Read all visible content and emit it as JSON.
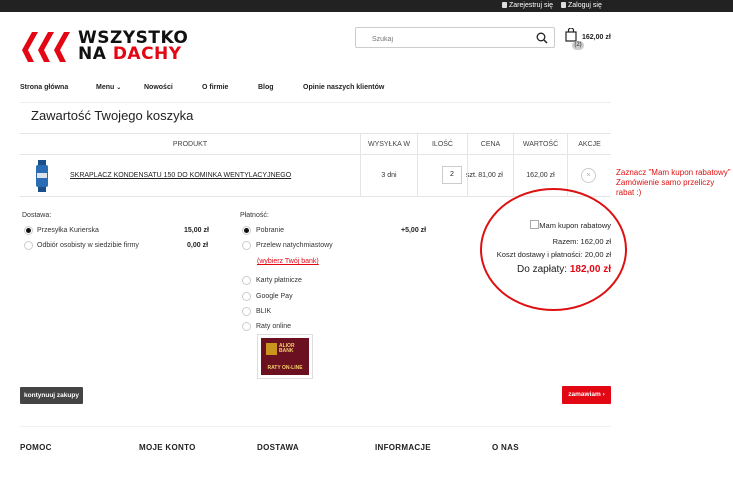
{
  "topbar": {
    "register": "Zarejestruj się",
    "login": "Zaloguj się"
  },
  "logo": {
    "line1": "WSZYSTKO",
    "line2_a": "NA ",
    "line2_b": "DACHY",
    "brand_red": "#e30613"
  },
  "search": {
    "placeholder": "Szukaj",
    "icon": "search-icon"
  },
  "cart": {
    "count": "(2)",
    "total": "162,00 zł",
    "icon": "shopping-bag-icon"
  },
  "nav": {
    "items": [
      {
        "label": "Strona główna"
      },
      {
        "label": "Menu"
      },
      {
        "label": "Nowości"
      },
      {
        "label": "O firmie"
      },
      {
        "label": "Blog"
      },
      {
        "label": "Opinie naszych klientów"
      }
    ]
  },
  "page_title": "Zawartość Twojego koszyka",
  "table": {
    "headers": [
      "PRODUKT",
      "WYSYŁKA W",
      "ILOŚĆ",
      "CENA",
      "WARTOŚĆ",
      "AKCJE"
    ],
    "row": {
      "name": "SKRAPLACZ KONDENSATU 150 DO KOMINKA WENTYLACYJNEGO",
      "shipping": "3 dni",
      "qty": "2",
      "unit": "szt.",
      "price": "81,00 zł",
      "value": "162,00 zł",
      "action": "×"
    }
  },
  "annotation": {
    "line1": "Zaznacz \"Mam kupon rabatowy\"",
    "line2": "Zamówienie samo przeliczy rabat :)"
  },
  "delivery": {
    "label": "Dostawa:",
    "options": [
      {
        "label": "Przesyłka Kurierska",
        "price": "15,00 zł",
        "selected": true
      },
      {
        "label": "Odbiór osobisty w siedzibie firmy",
        "price": "0,00 zł",
        "selected": false
      }
    ]
  },
  "payment": {
    "label": "Płatność:",
    "options": [
      {
        "label": "Pobranie",
        "price": "+5,00 zł",
        "selected": true
      },
      {
        "label": "Przelew natychmiastowy",
        "selected": false
      },
      {
        "label": "Karty płatnicze",
        "selected": false
      },
      {
        "label": "Google Pay",
        "selected": false
      },
      {
        "label": "BLIK",
        "selected": false
      },
      {
        "label": "Raty online",
        "selected": false
      }
    ],
    "bank_link": "(wybierz Twój bank)",
    "alior": {
      "name": "ALIOR BANK",
      "tag": "RATY ON-LINE"
    }
  },
  "summary": {
    "coupon_label": "Mam kupon rabatowy",
    "subtotal": "Razem: 162,00 zł",
    "shipping_cost": "Koszt dostawy i płatności: 20,00 zł",
    "to_pay_label": "Do zapłaty:",
    "to_pay_value": "182,00 zł"
  },
  "buttons": {
    "continue": "kontynuuj zakupy",
    "order": "zamawiam ›"
  },
  "footer": {
    "columns": [
      "POMOC",
      "MOJE KONTO",
      "DOSTAWA",
      "INFORMACJE",
      "O NAS"
    ]
  }
}
